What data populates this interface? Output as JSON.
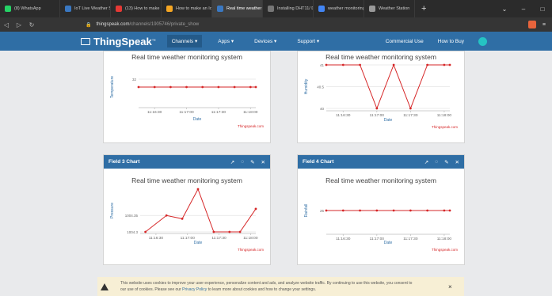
{
  "browser": {
    "tabs": [
      {
        "label": "(8) WhatsApp",
        "color": "#25d366"
      },
      {
        "label": "IoT Live Weather Stat",
        "color": "#3a78c2"
      },
      {
        "label": "(13) How to make an I",
        "color": "#e53935"
      },
      {
        "label": "How to make an IoT b",
        "color": "#f5a623"
      },
      {
        "label": "Real time weather",
        "color": "#3a78c2",
        "active": true
      },
      {
        "label": "Installing DHT11/ DH",
        "color": "#777777"
      },
      {
        "label": "weather monitoring",
        "color": "#4285f4"
      },
      {
        "label": "Weather Station",
        "color": "#999999"
      }
    ],
    "url_host": "thingspeak.com",
    "url_path": "/channels/1905746/private_show"
  },
  "nav": {
    "logo": "ThingSpeak",
    "items": [
      "Channels ▾",
      "Apps ▾",
      "Devices ▾",
      "Support ▾"
    ],
    "commercial": "Commercial Use",
    "buy": "How to Buy"
  },
  "charts": [
    {
      "header": "",
      "chart_data": {
        "type": "line",
        "title": "Real time weather monitoring system",
        "xlabel": "Date",
        "ylabel": "Temperature",
        "x": [
          "11:16:15",
          "11:16:30",
          "11:16:45",
          "11:17:00",
          "11:17:15",
          "11:17:30",
          "11:17:45",
          "11:18:00",
          "11:18:05"
        ],
        "y": [
          32,
          32,
          32,
          32,
          32,
          32,
          32,
          32,
          32
        ],
        "yticks": [
          "32"
        ],
        "xticks": [
          "11:16:30",
          "11:17:00",
          "11:17:30",
          "11:18:00"
        ],
        "ylim": [
          31,
          33
        ],
        "credit": "Thingspeak.com"
      }
    },
    {
      "header": "",
      "chart_data": {
        "type": "line",
        "title": "Real time weather monitoring system",
        "xlabel": "Date",
        "ylabel": "Humidity",
        "x": [
          "11:16:15",
          "11:16:30",
          "11:16:45",
          "11:17:00",
          "11:17:15",
          "11:17:30",
          "11:17:45",
          "11:18:00",
          "11:18:05"
        ],
        "y": [
          41,
          41,
          41,
          40,
          41,
          40,
          41,
          41,
          41
        ],
        "yticks": [
          "41",
          "40.5",
          "40"
        ],
        "xticks": [
          "11:16:30",
          "11:17:00",
          "11:17:30",
          "11:18:00"
        ],
        "ylim": [
          40,
          41
        ],
        "credit": "Thingspeak.com"
      }
    },
    {
      "header": "Field 3 Chart",
      "chart_data": {
        "type": "line",
        "title": "Real time weather monitoring system",
        "xlabel": "Date",
        "ylabel": "Pressure",
        "x": [
          "11:16:20",
          "11:16:40",
          "11:16:55",
          "11:17:10",
          "11:17:25",
          "11:17:40",
          "11:17:50",
          "11:18:05"
        ],
        "y": [
          1004.3,
          1004.35,
          1004.34,
          1004.43,
          1004.3,
          1004.3,
          1004.3,
          1004.37
        ],
        "yticks": [
          "1004.35",
          "1004.3"
        ],
        "xticks": [
          "11:16:30",
          "11:17:00",
          "11:17:30",
          "11:18:00"
        ],
        "ylim": [
          1004.3,
          1004.43
        ],
        "credit": "Thingspeak.com"
      }
    },
    {
      "header": "Field 4 Chart",
      "chart_data": {
        "type": "line",
        "title": "Real time weather monitoring system",
        "xlabel": "Date",
        "ylabel": "Rainfall",
        "x": [
          "11:16:15",
          "11:16:30",
          "11:16:45",
          "11:17:00",
          "11:17:15",
          "11:17:30",
          "11:17:45",
          "11:18:00",
          "11:18:05"
        ],
        "y": [
          25,
          25,
          25,
          25,
          25,
          25,
          25,
          25,
          25
        ],
        "yticks": [
          "25"
        ],
        "xticks": [
          "11:16:30",
          "11:17:00",
          "11:17:30",
          "11:18:00"
        ],
        "ylim": [
          24,
          26
        ],
        "credit": "Thingspeak.com"
      }
    }
  ],
  "cookie": {
    "line1": "This website uses cookies to improve your user experience, personalize content and ads, and analyze website traffic. By continuing to use this website, you consent to",
    "line2a": "our use of cookies. Please see our ",
    "link": "Privacy Policy",
    "line2b": " to learn more about cookies and how to change your settings.",
    "close": "×"
  },
  "colors": {
    "brand": "#2f6ea5",
    "line": "#d62728"
  }
}
